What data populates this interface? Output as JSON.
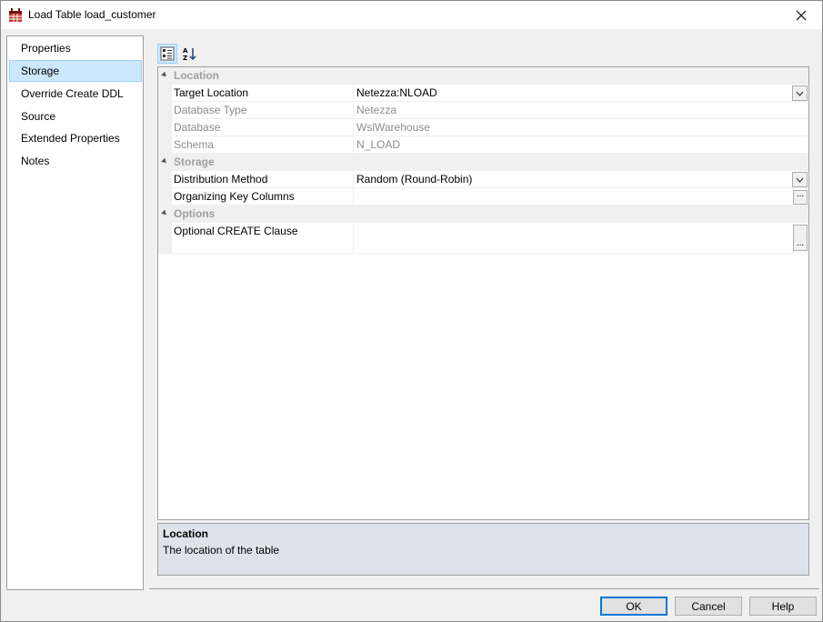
{
  "window": {
    "title": "Load Table load_customer"
  },
  "nav": {
    "items": [
      {
        "label": "Properties",
        "selected": false
      },
      {
        "label": "Storage",
        "selected": true
      },
      {
        "label": "Override Create DDL",
        "selected": false
      },
      {
        "label": "Source",
        "selected": false
      },
      {
        "label": "Extended Properties",
        "selected": false
      },
      {
        "label": "Notes",
        "selected": false
      }
    ]
  },
  "grid": {
    "categories": {
      "location": "Location",
      "storage": "Storage",
      "options": "Options"
    },
    "rows": {
      "target_location": {
        "name": "Target Location",
        "value": "Netezza:NLOAD"
      },
      "database_type": {
        "name": "Database Type",
        "value": "Netezza"
      },
      "database": {
        "name": "Database",
        "value": "WslWarehouse"
      },
      "schema": {
        "name": "Schema",
        "value": "N_LOAD"
      },
      "distribution_method": {
        "name": "Distribution Method",
        "value": "Random (Round-Robin)"
      },
      "organizing_key_columns": {
        "name": "Organizing Key Columns",
        "value": ""
      },
      "optional_create_clause": {
        "name": "Optional CREATE Clause",
        "value": ""
      }
    },
    "ellipsis": "..."
  },
  "description": {
    "title": "Location",
    "text": "The location of the table"
  },
  "buttons": {
    "ok": "OK",
    "cancel": "Cancel",
    "help": "Help"
  },
  "colors": {
    "selection": "#cce8ff",
    "selection_border": "#99d1ff",
    "default_button_border": "#0078d7",
    "description_bg": "#dee2ea"
  }
}
